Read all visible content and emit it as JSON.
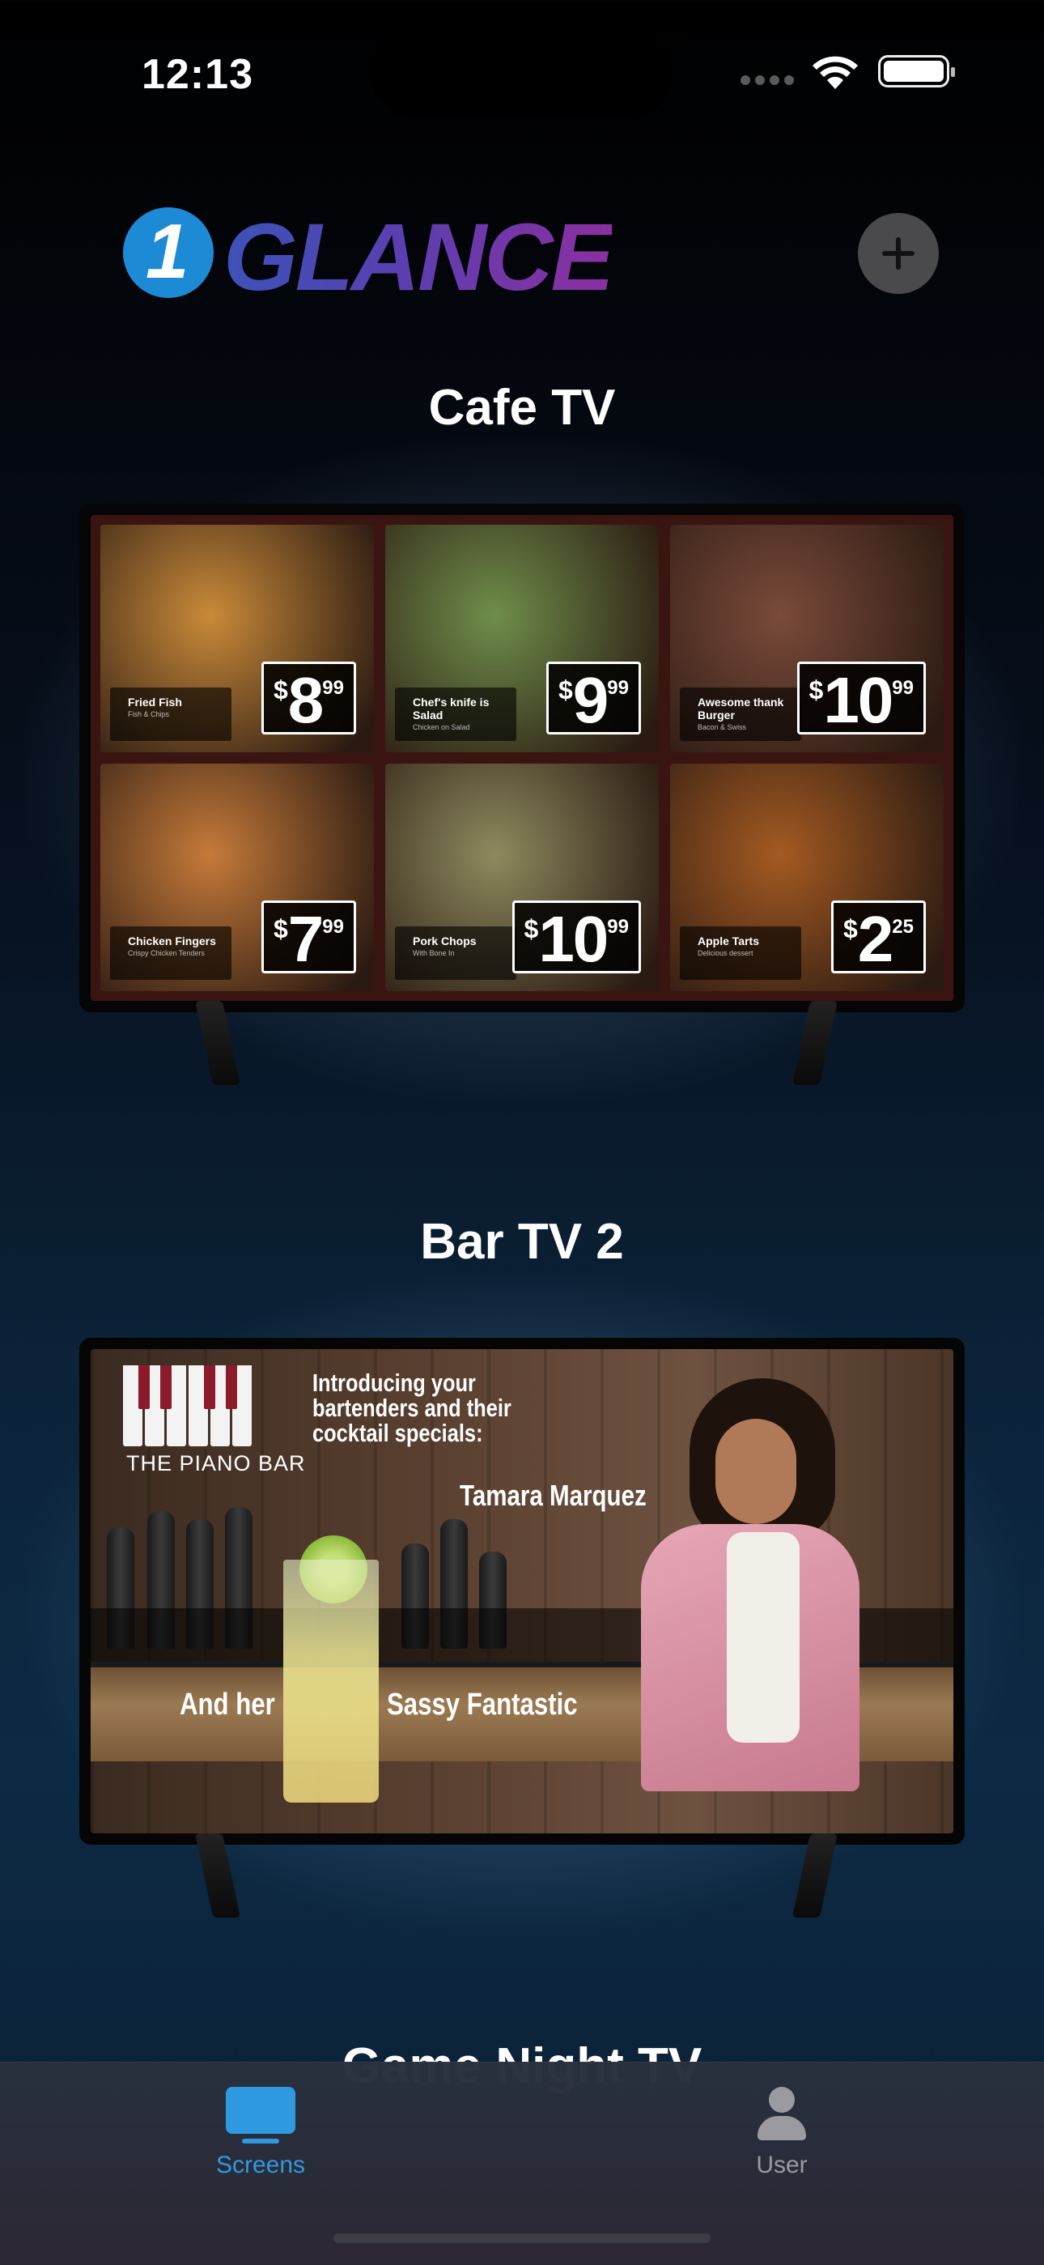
{
  "status_bar": {
    "time": "12:13"
  },
  "header": {
    "logo_number": "1",
    "logo_text": "GLANCE",
    "add_button": "+"
  },
  "screens": [
    {
      "title": "Cafe TV",
      "menu": [
        {
          "name": "Fried Fish",
          "sub": "Fish & Chips",
          "currency": "$",
          "dollars": "8",
          "cents": "99",
          "color": "#c98a3a"
        },
        {
          "name": "Chef's knife is Salad",
          "sub": "Chicken on Salad",
          "currency": "$",
          "dollars": "9",
          "cents": "99",
          "color": "#6f8e4a"
        },
        {
          "name": "Awesome thank Burger",
          "sub": "Bacon & Swiss",
          "currency": "$",
          "dollars": "10",
          "cents": "99",
          "color": "#7a4a3a"
        },
        {
          "name": "Chicken Fingers",
          "sub": "Crispy Chicken Tenders",
          "currency": "$",
          "dollars": "7",
          "cents": "99",
          "color": "#c57a3a"
        },
        {
          "name": "Pork Chops",
          "sub": "With Bone In",
          "currency": "$",
          "dollars": "10",
          "cents": "99",
          "color": "#8e8a5e"
        },
        {
          "name": "Apple Tarts",
          "sub": "Delicious dessert",
          "currency": "$",
          "dollars": "2",
          "cents": "25",
          "color": "#a45a22"
        }
      ]
    },
    {
      "title": "Bar TV 2",
      "piano_label": "THE PIANO BAR",
      "intro": "Introducing your bartenders and their cocktail specials:",
      "bartender": "Tamara Marquez",
      "and_her": "And her",
      "cocktail": "Sassy Fantastic"
    }
  ],
  "next_screen_title": "Game Night TV",
  "tabs": [
    {
      "label": "Screens",
      "icon": "tv-icon",
      "color": "#2f9ae0"
    },
    {
      "label": "User",
      "icon": "user-icon",
      "color": "#9a9aa0"
    }
  ]
}
